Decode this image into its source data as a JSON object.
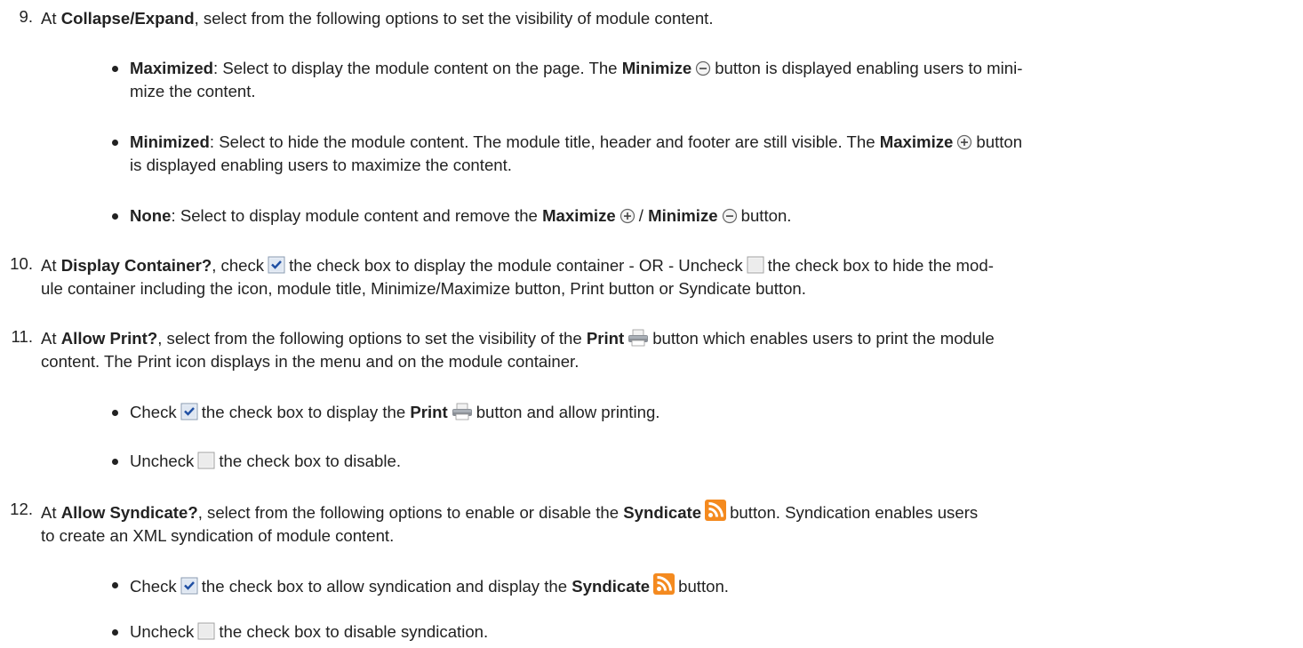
{
  "steps": [
    {
      "number": "9.",
      "parts": [
        {
          "t": "At "
        },
        {
          "b": "Collapse/Expand"
        },
        {
          "t": ", select from the following options to set the visibility of module content."
        }
      ],
      "bullets": [
        {
          "parts": [
            {
              "b": "Maximized"
            },
            {
              "t": ": Select to display the module content on the page. The "
            },
            {
              "b": "Minimize"
            },
            {
              "icon": "minimize-icon"
            },
            {
              "t": "button is displayed enabling users to mini-"
            },
            {
              "br": true
            },
            {
              "t": "mize the content."
            }
          ]
        },
        {
          "parts": [
            {
              "b": "Minimized"
            },
            {
              "t": ": Select to hide the module content. The module title, header and footer are still visible. The "
            },
            {
              "b": "Maximize"
            },
            {
              "icon": "maximize-icon"
            },
            {
              "t": "button"
            },
            {
              "br": true
            },
            {
              "t": "is displayed enabling users to maximize the content."
            }
          ]
        },
        {
          "parts": [
            {
              "b": "None"
            },
            {
              "t": ": Select to display module content and remove the "
            },
            {
              "b": "Maximize"
            },
            {
              "icon": "maximize-icon"
            },
            {
              "t": "/ "
            },
            {
              "b": "Minimize"
            },
            {
              "icon": "minimize-icon"
            },
            {
              "t": "button."
            }
          ]
        }
      ]
    },
    {
      "number": "10.",
      "parts": [
        {
          "t": "At "
        },
        {
          "b": "Display Container?"
        },
        {
          "t": ", check"
        },
        {
          "icon": "checkbox-checked-icon"
        },
        {
          "t": "the check box to display the module container - OR - Uncheck"
        },
        {
          "icon": "checkbox-unchecked-icon"
        },
        {
          "t": "the check box to hide the mod-"
        },
        {
          "br": true
        },
        {
          "t": "ule container including the icon, module title, Minimize/Maximize button, Print button or Syndicate button."
        }
      ],
      "bullets": []
    },
    {
      "number": "11.",
      "parts": [
        {
          "t": "At "
        },
        {
          "b": "Allow Print?"
        },
        {
          "t": ", select from the following options to set the visibility of the "
        },
        {
          "b": "Print"
        },
        {
          "icon": "print-icon"
        },
        {
          "t": "button which enables users to print the module"
        },
        {
          "br": true
        },
        {
          "t": "content. The Print icon displays in the menu and on the module container."
        }
      ],
      "bullets": [
        {
          "parts": [
            {
              "t": "Check"
            },
            {
              "icon": "checkbox-checked-icon"
            },
            {
              "t": "the check box to display the "
            },
            {
              "b": "Print"
            },
            {
              "icon": "print-icon"
            },
            {
              "t": "button and allow printing."
            }
          ]
        },
        {
          "parts": [
            {
              "t": "Uncheck"
            },
            {
              "icon": "checkbox-unchecked-icon"
            },
            {
              "t": "the check box to disable."
            }
          ]
        }
      ]
    },
    {
      "number": "12.",
      "parts": [
        {
          "t": "At "
        },
        {
          "b": "Allow Syndicate?"
        },
        {
          "t": ", select from the following options to enable or disable the "
        },
        {
          "b": "Syndicate"
        },
        {
          "icon": "rss-icon"
        },
        {
          "t": "button. Syndication enables users"
        },
        {
          "br": true
        },
        {
          "t": "to create an XML syndication of module content."
        }
      ],
      "bullets": [
        {
          "parts": [
            {
              "t": "Check"
            },
            {
              "icon": "checkbox-checked-icon"
            },
            {
              "t": "the check box to allow syndication and display the "
            },
            {
              "b": "Syndicate"
            },
            {
              "icon": "rss-icon"
            },
            {
              "t": "button."
            }
          ]
        },
        {
          "parts": [
            {
              "t": "Uncheck"
            },
            {
              "icon": "checkbox-unchecked-icon"
            },
            {
              "t": "the check box to disable syndication."
            }
          ]
        }
      ]
    }
  ]
}
